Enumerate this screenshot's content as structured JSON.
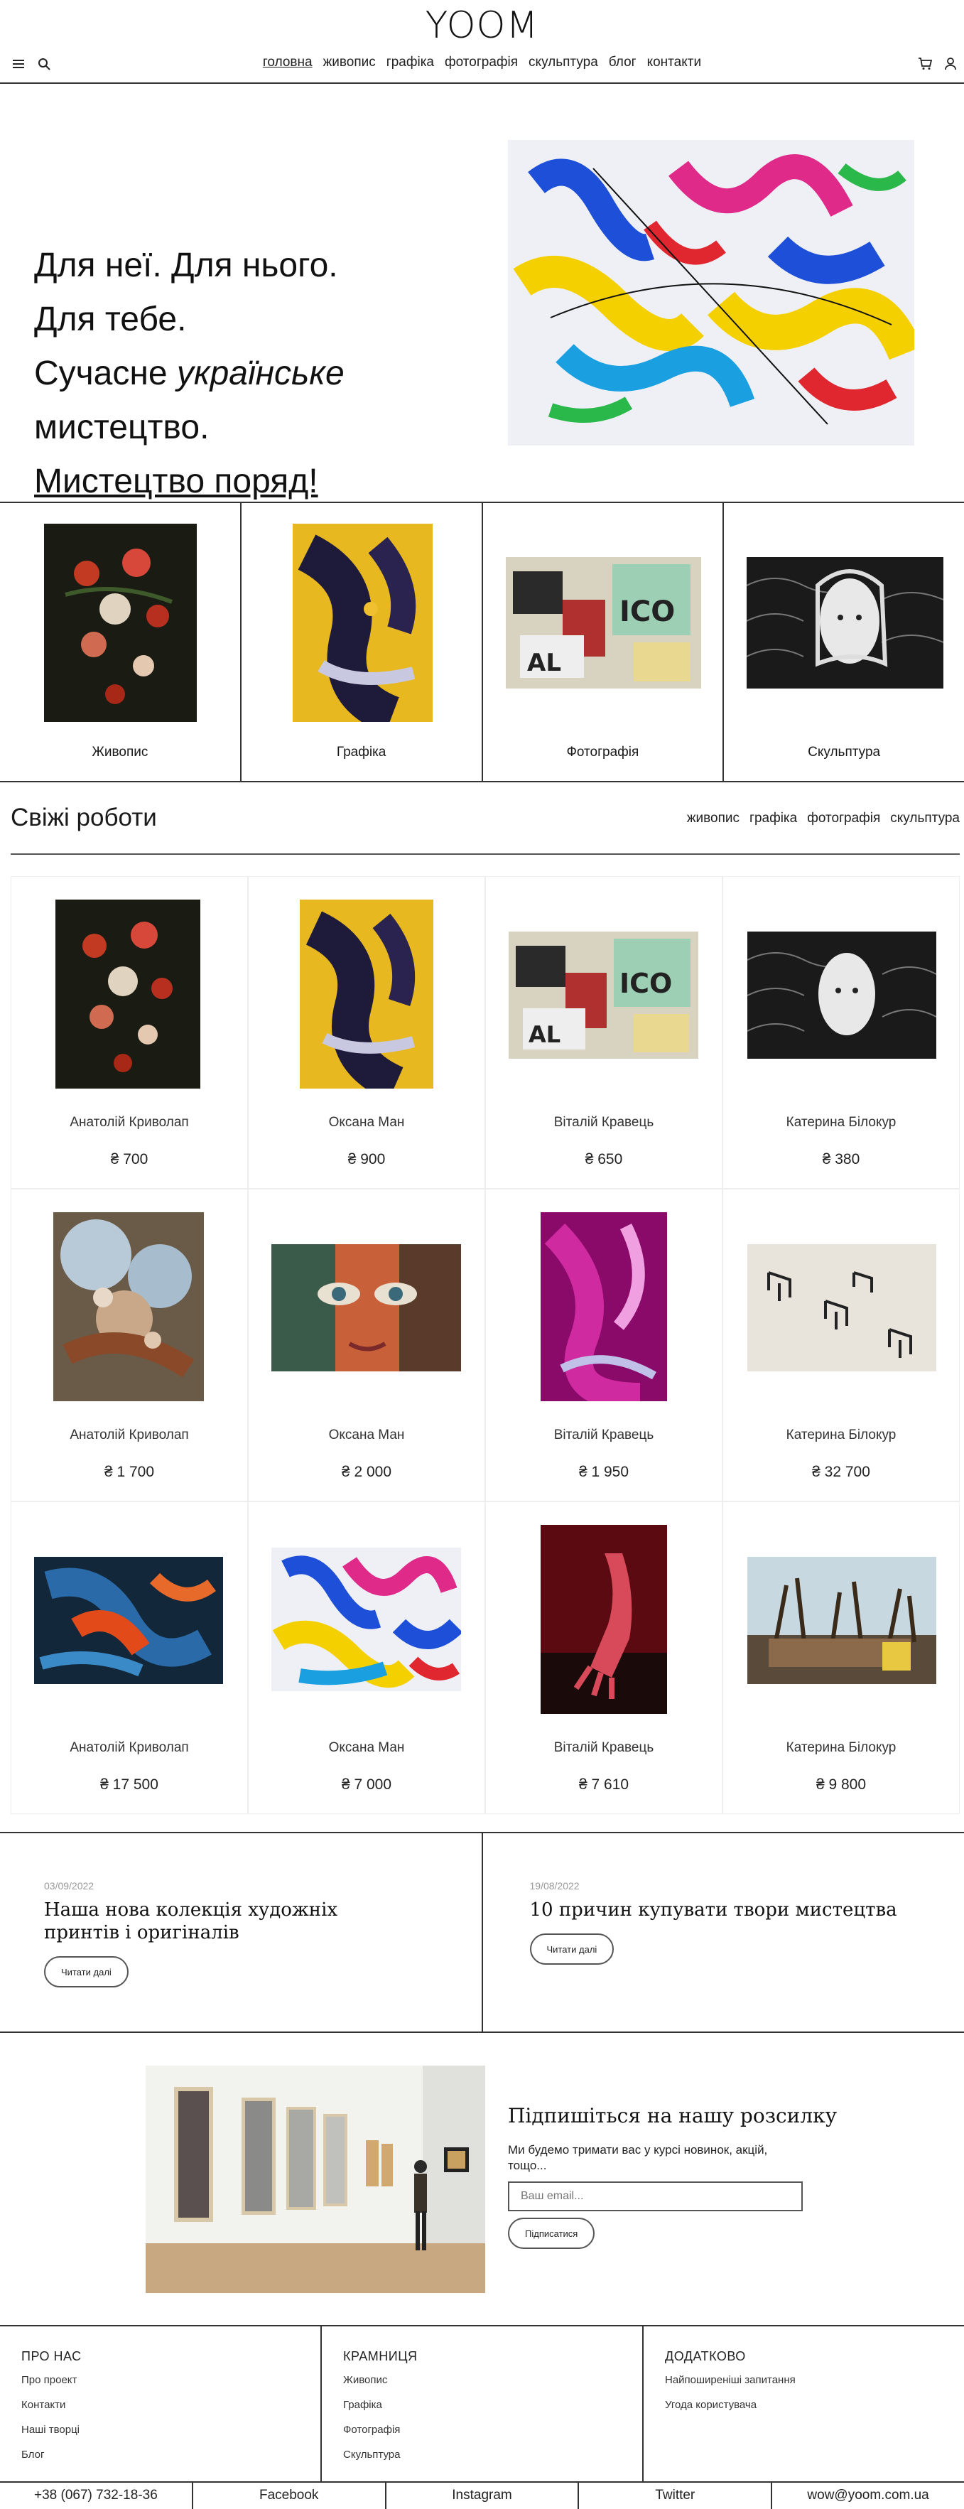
{
  "header": {
    "logo": "YOOM",
    "nav": [
      "головна",
      "живопис",
      "графіка",
      "фотографія",
      "скульптура",
      "блог",
      "контакти"
    ]
  },
  "hero": {
    "line1": "Для неї. Для нього.",
    "line2": "Для тебе.",
    "line3_a": "Сучасне ",
    "line3_b": "українське",
    "line4": "мистецтво.",
    "link": "Мистецтво поряд!"
  },
  "categories": [
    "Живопис",
    "Графіка",
    "Фотографія",
    "Скульптура"
  ],
  "fresh": {
    "title": "Свіжі роботи",
    "filters": [
      "живопис",
      "графіка",
      "фотографія",
      "скульптура"
    ]
  },
  "works": [
    {
      "artist": "Анатолій Криволап",
      "price": "₴ 700"
    },
    {
      "artist": "Оксана Ман",
      "price": "₴ 900"
    },
    {
      "artist": "Віталій Кравець",
      "price": "₴ 650"
    },
    {
      "artist": "Катерина Білокур",
      "price": "₴ 380"
    },
    {
      "artist": "Анатолій Криволап",
      "price": "₴ 1 700"
    },
    {
      "artist": "Оксана Ман",
      "price": "₴ 2 000"
    },
    {
      "artist": "Віталій Кравець",
      "price": "₴ 1 950"
    },
    {
      "artist": "Катерина Білокур",
      "price": "₴ 32 700"
    },
    {
      "artist": "Анатолій Криволап",
      "price": "₴ 17 500"
    },
    {
      "artist": "Оксана Ман",
      "price": "₴ 7 000"
    },
    {
      "artist": "Віталій Кравець",
      "price": "₴ 7 610"
    },
    {
      "artist": "Катерина Білокур",
      "price": "₴ 9 800"
    }
  ],
  "blog": [
    {
      "date": "03/09/2022",
      "title": "Наша нова колекція художніх принтів і оригіналів",
      "button": "Читати далі"
    },
    {
      "date": "19/08/2022",
      "title": "10 причин купувати твори мистецтва",
      "button": "Читати далі"
    }
  ],
  "newsletter": {
    "title": "Підпишіться на нашу розсилку",
    "text": "Ми будемо тримати вас у курсі новинок, акцій, тощо...",
    "placeholder": "Ваш email...",
    "button": "Підписатися"
  },
  "footer": {
    "about": {
      "title": "ПРО НАС",
      "links": [
        "Про проект",
        "Контакти",
        "Наші творці",
        "Блог"
      ]
    },
    "shop": {
      "title": "КРАМНИЦЯ",
      "links": [
        "Живопис",
        "Графіка",
        "Фотографія",
        "Скульптура"
      ]
    },
    "extra": {
      "title": "ДОДАТКОВО",
      "links": [
        "Найпоширеніші запитання",
        "Угода користувача"
      ]
    }
  },
  "bottom": [
    "+38 (067) 732-18-36",
    "Facebook",
    "Instagram",
    "Twitter",
    "wow@yoom.com.ua"
  ],
  "icons": [
    "menu-icon",
    "search-icon",
    "cart-icon",
    "user-icon"
  ]
}
